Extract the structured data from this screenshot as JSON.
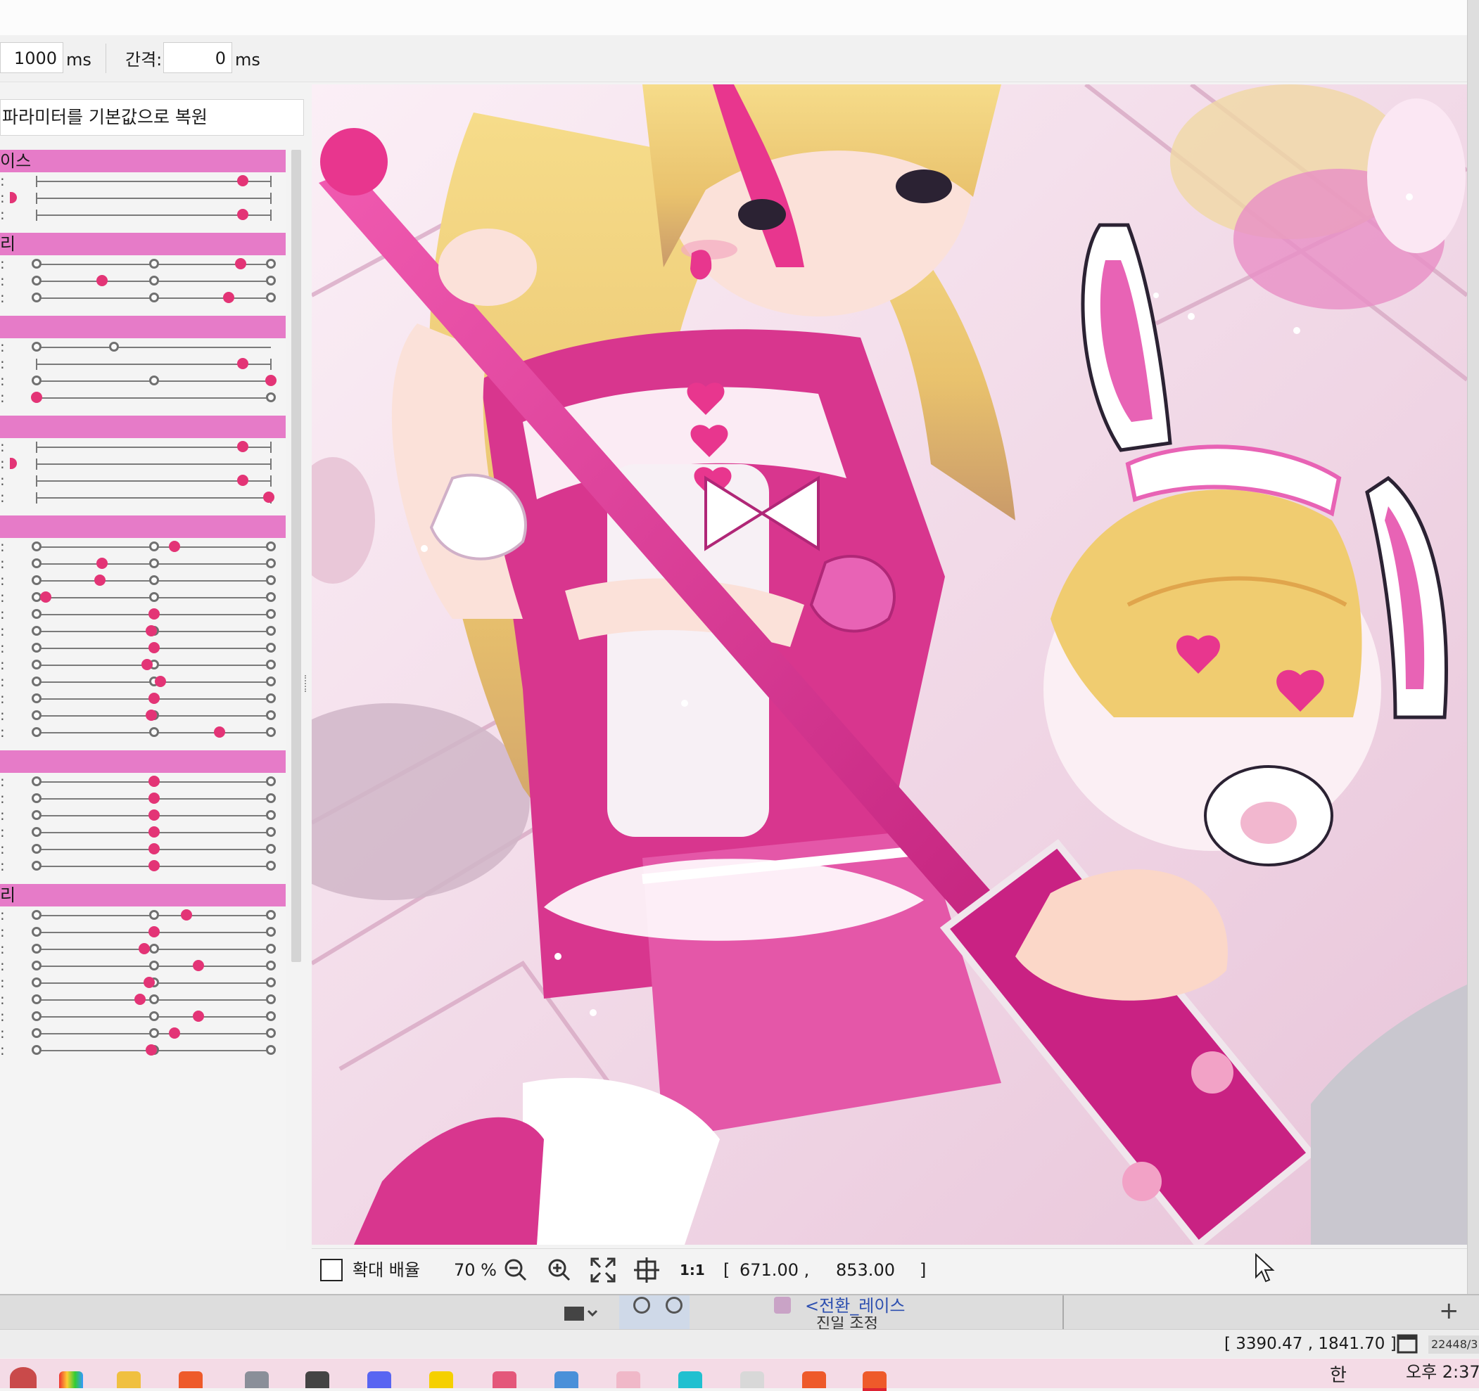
{
  "toolbar": {
    "duration_value": "1000",
    "duration_unit": "ms",
    "interval_label": "간격:",
    "interval_value": "0",
    "interval_unit": "ms"
  },
  "panel": {
    "reset_button": "파라미터를 기본값으로 복원",
    "groups": [
      {
        "label": "이스"
      },
      {
        "label": "리"
      },
      {
        "label": ""
      },
      {
        "label": ""
      },
      {
        "label": ""
      },
      {
        "label": ""
      },
      {
        "label": "리"
      }
    ],
    "row_prefix": ":"
  },
  "params": [
    {
      "group": 0,
      "type": "range",
      "value": 0.88,
      "rings": []
    },
    {
      "group": 0,
      "type": "range",
      "value": 0.0,
      "rings": []
    },
    {
      "group": 0,
      "type": "range",
      "value": 0.88,
      "rings": []
    },
    {
      "group": 1,
      "type": "dial",
      "value": 0.87,
      "rings": [
        0,
        0.5,
        1
      ]
    },
    {
      "group": 1,
      "type": "dial",
      "value": 0.28,
      "rings": [
        0,
        0.5,
        1
      ]
    },
    {
      "group": 1,
      "type": "dial",
      "value": 0.82,
      "rings": [
        0,
        0.5,
        1
      ]
    },
    {
      "group": 2,
      "type": "dial",
      "value": null,
      "rings": [
        0,
        0.33
      ]
    },
    {
      "group": 2,
      "type": "range",
      "value": 0.88,
      "rings": []
    },
    {
      "group": 2,
      "type": "dial",
      "value": 1.0,
      "rings": [
        0,
        0.5,
        1
      ]
    },
    {
      "group": 2,
      "type": "dial",
      "value": 0.0,
      "rings": [
        0,
        1
      ]
    },
    {
      "group": 3,
      "type": "range",
      "value": 0.88,
      "rings": []
    },
    {
      "group": 3,
      "type": "range",
      "value": 0.0,
      "rings": []
    },
    {
      "group": 3,
      "type": "range",
      "value": 0.88,
      "rings": []
    },
    {
      "group": 3,
      "type": "range",
      "value": 0.99,
      "rings": []
    },
    {
      "group": 4,
      "type": "dial",
      "value": 0.59,
      "rings": [
        0,
        0.5,
        1
      ]
    },
    {
      "group": 4,
      "type": "dial",
      "value": 0.28,
      "rings": [
        0,
        0.5,
        1
      ]
    },
    {
      "group": 4,
      "type": "dial",
      "value": 0.27,
      "rings": [
        0,
        0.5,
        1
      ]
    },
    {
      "group": 4,
      "type": "dial",
      "value": 0.04,
      "rings": [
        0,
        0.5,
        1
      ]
    },
    {
      "group": 4,
      "type": "dial",
      "value": 0.5,
      "rings": [
        0,
        0.5,
        1
      ]
    },
    {
      "group": 4,
      "type": "dial",
      "value": 0.49,
      "rings": [
        0,
        0.5,
        1
      ]
    },
    {
      "group": 4,
      "type": "dial",
      "value": 0.5,
      "rings": [
        0,
        0.5,
        1
      ]
    },
    {
      "group": 4,
      "type": "dial",
      "value": 0.47,
      "rings": [
        0,
        0.5,
        1
      ]
    },
    {
      "group": 4,
      "type": "dial",
      "value": 0.53,
      "rings": [
        0,
        0.5,
        1
      ]
    },
    {
      "group": 4,
      "type": "dial",
      "value": 0.5,
      "rings": [
        0,
        0.5,
        1
      ]
    },
    {
      "group": 4,
      "type": "dial",
      "value": 0.49,
      "rings": [
        0,
        0.5,
        1
      ]
    },
    {
      "group": 4,
      "type": "dial",
      "value": 0.78,
      "rings": [
        0,
        0.5,
        1
      ]
    },
    {
      "group": 5,
      "type": "dial",
      "value": 0.5,
      "rings": [
        0,
        0.5,
        1
      ]
    },
    {
      "group": 5,
      "type": "dial",
      "value": 0.5,
      "rings": [
        0,
        0.5,
        1
      ]
    },
    {
      "group": 5,
      "type": "dial",
      "value": 0.5,
      "rings": [
        0,
        0.5,
        1
      ]
    },
    {
      "group": 5,
      "type": "dial",
      "value": 0.5,
      "rings": [
        0,
        0.5,
        1
      ]
    },
    {
      "group": 5,
      "type": "dial",
      "value": 0.5,
      "rings": [
        0,
        0.5,
        1
      ]
    },
    {
      "group": 5,
      "type": "dial",
      "value": 0.5,
      "rings": [
        0,
        0.5,
        1
      ]
    },
    {
      "group": 6,
      "type": "dial",
      "value": 0.64,
      "rings": [
        0,
        0.5,
        1
      ]
    },
    {
      "group": 6,
      "type": "dial",
      "value": 0.5,
      "rings": [
        0,
        0.5,
        1
      ]
    },
    {
      "group": 6,
      "type": "dial",
      "value": 0.46,
      "rings": [
        0,
        0.5,
        1
      ]
    },
    {
      "group": 6,
      "type": "dial",
      "value": 0.69,
      "rings": [
        0,
        0.5,
        1
      ]
    },
    {
      "group": 6,
      "type": "dial",
      "value": 0.48,
      "rings": [
        0,
        0.5,
        1
      ]
    },
    {
      "group": 6,
      "type": "dial",
      "value": 0.44,
      "rings": [
        0,
        0.5,
        1
      ]
    },
    {
      "group": 6,
      "type": "dial",
      "value": 0.69,
      "rings": [
        0,
        0.5,
        1
      ]
    },
    {
      "group": 6,
      "type": "dial",
      "value": 0.59,
      "rings": [
        0,
        0.5,
        1
      ]
    },
    {
      "group": 6,
      "type": "dial",
      "value": 0.49,
      "rings": [
        0,
        0.5,
        1
      ]
    }
  ],
  "statusbar": {
    "zoom_label": "확대 배율",
    "zoom_value": "70 %",
    "one_to_one": "1:1",
    "coord_open": "[",
    "coord_x": "671.00 ,",
    "coord_y": "853.00",
    "coord_close": "]"
  },
  "background_window": {
    "layer_name": "<전환_레이스",
    "layer_name2": "진일 조정"
  },
  "app_status": {
    "coords": "[ 3390.47 , 1841.70 ]",
    "memory": "22448/3"
  },
  "taskbar": {
    "ime": "한",
    "clock": "오후 2:37"
  },
  "colors": {
    "group_header": "#e67bc8",
    "knob": "#e33476",
    "accent_pink": "#d8368e"
  },
  "icons": {
    "zoom_out": "magnifier-minus-icon",
    "zoom_in": "magnifier-plus-icon",
    "fit": "fit-to-window-icon",
    "center": "center-crosshair-icon",
    "cursor": "mouse-pointer-icon"
  }
}
